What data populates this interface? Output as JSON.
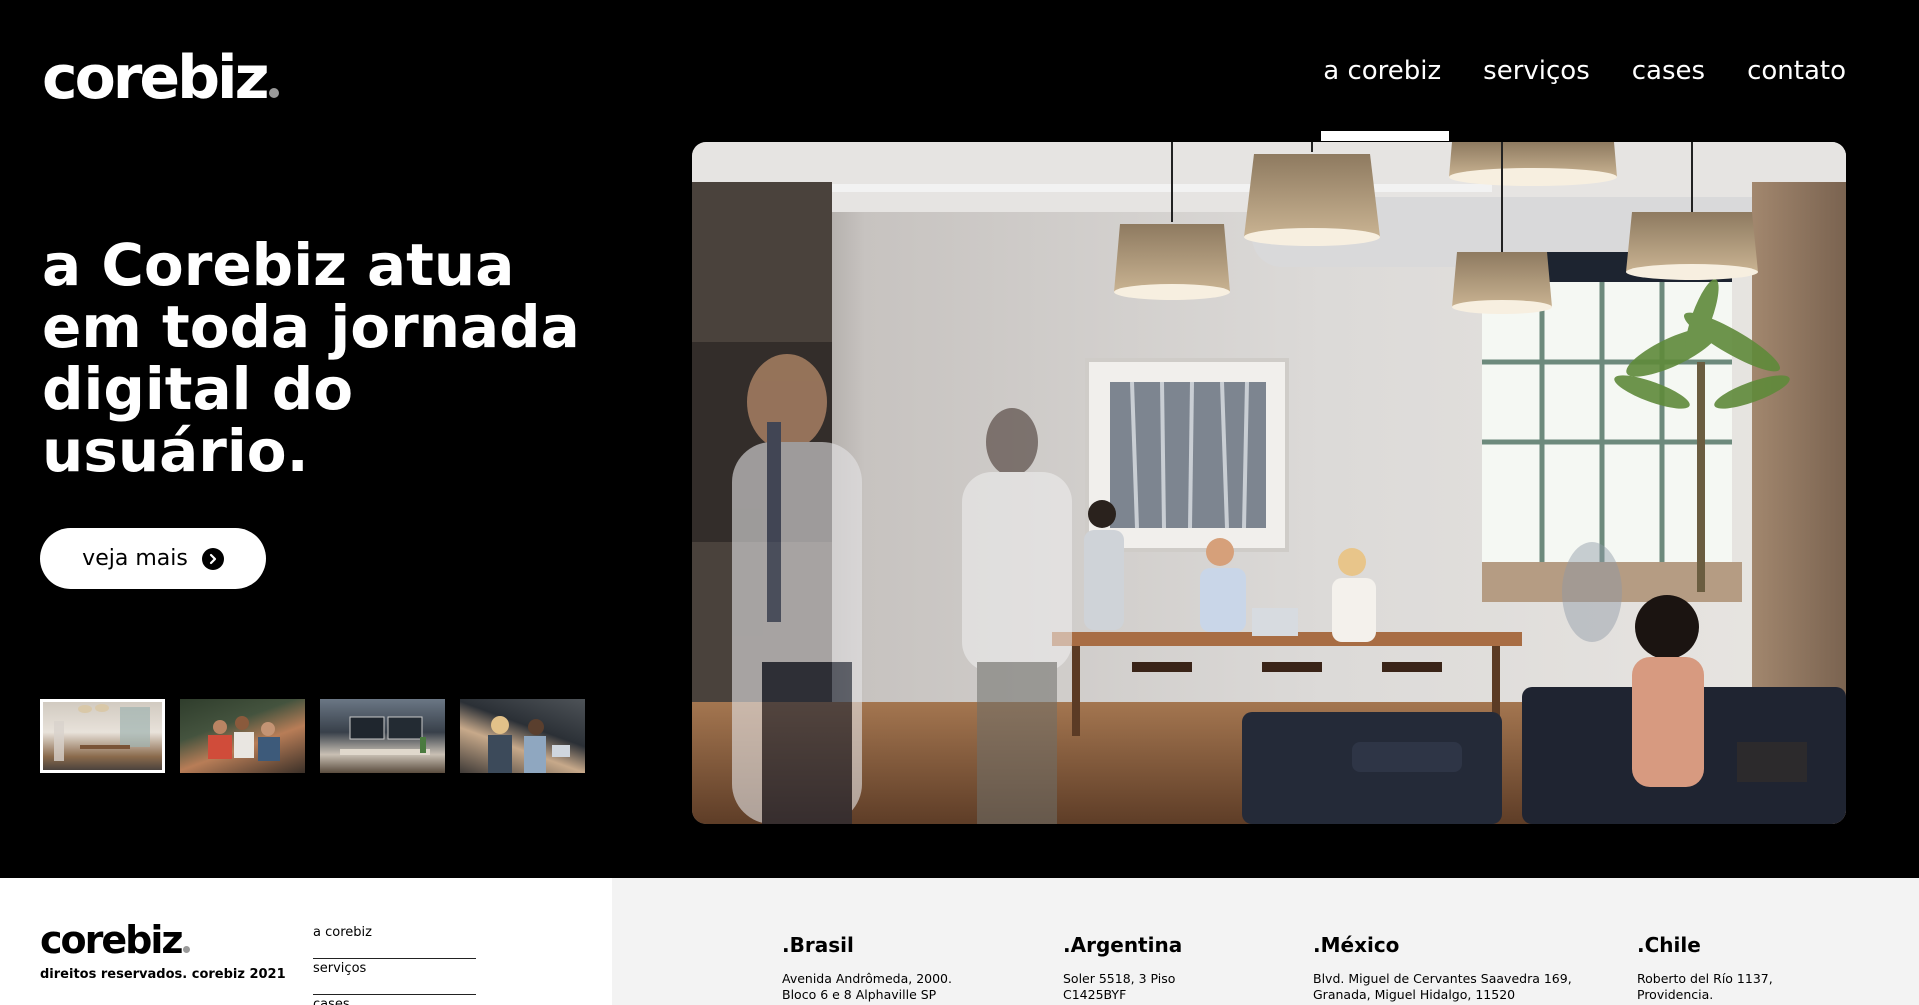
{
  "brand": {
    "name": "corebiz"
  },
  "nav": {
    "items": [
      {
        "label": "a corebiz"
      },
      {
        "label": "serviços"
      },
      {
        "label": "cases"
      },
      {
        "label": "contato"
      }
    ]
  },
  "hero": {
    "headline": "a Corebiz atua em toda jornada digital do usuário.",
    "cta_label": "veja mais"
  },
  "footer": {
    "copyright": "direitos reservados. corebiz 2021",
    "links": [
      {
        "label": "a corebiz"
      },
      {
        "label": "serviços"
      },
      {
        "label": "cases"
      }
    ],
    "offices": [
      {
        "country": ".Brasil",
        "line1": "Avenida Andrômeda, 2000.",
        "line2": "Bloco 6 e 8 Alphaville SP"
      },
      {
        "country": ".Argentina",
        "line1": "Soler 5518, 3 Piso",
        "line2": "C1425BYF"
      },
      {
        "country": ".México",
        "line1": "Blvd. Miguel de Cervantes Saavedra 169,",
        "line2": "Granada, Miguel Hidalgo, 11520"
      },
      {
        "country": ".Chile",
        "line1": "Roberto del Río 1137,",
        "line2": "Providencia."
      }
    ]
  },
  "colors": {
    "background": "#000000",
    "footer_left": "#ffffff",
    "footer_right": "#f3f3f3",
    "accent": "#ffffff"
  }
}
